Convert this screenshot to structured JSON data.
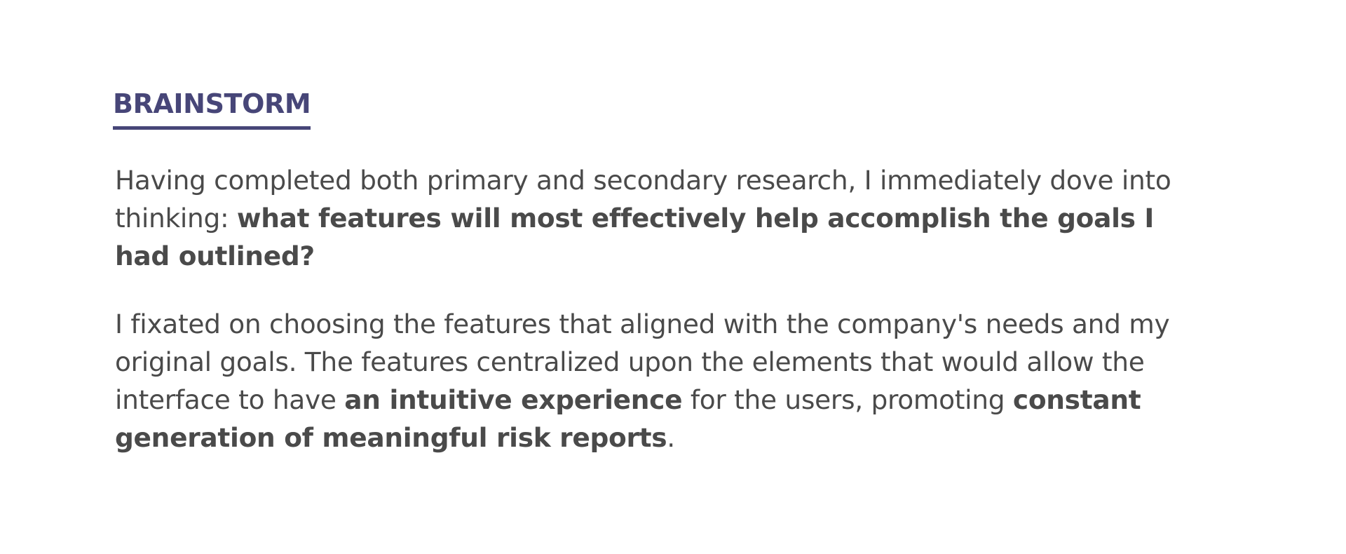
{
  "section": {
    "heading": "BRAINSTORM",
    "paragraph1": {
      "text_regular": "Having completed both primary and secondary research, I immediately dove into thinking: ",
      "text_bold": "what features will most effectively help accomplish the goals I had outlined?"
    },
    "paragraph2": {
      "text_regular_1": "I fixated on choosing the features that aligned with the company's needs and my original goals. The features centralized upon the elements that would allow the interface to have ",
      "text_bold_1": "an intuitive experience",
      "text_regular_2": " for the users, promoting ",
      "text_bold_2": "constant generation of meaningful risk reports",
      "text_regular_3": "."
    }
  },
  "colors": {
    "accent": "#474678",
    "body_text": "#4a4a4a",
    "background": "#ffffff"
  }
}
